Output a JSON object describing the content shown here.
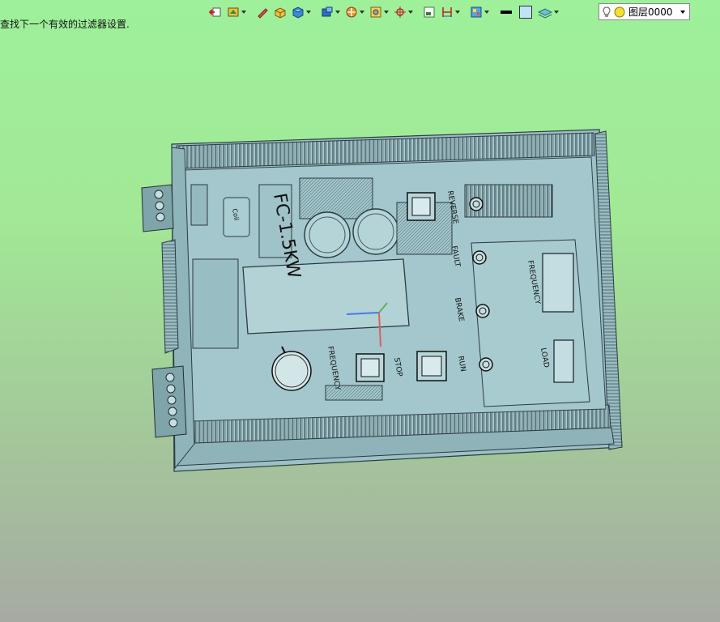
{
  "status": {
    "message": "查找下一个有效的过滤器设置."
  },
  "toolbar": {
    "icons": [
      "exit-sketch-icon",
      "snap-filter-icon",
      "pencil-icon",
      "box-solid-icon",
      "shaded-cube-icon",
      "render-style-icon",
      "section-view-icon",
      "wcs-display-icon",
      "csys-icon",
      "frame-icon",
      "dimension-icon",
      "view-palette-icon",
      "line-color-icon",
      "background-icon",
      "layer-visibility-icon"
    ]
  },
  "layer": {
    "current": "图层0000"
  },
  "model": {
    "labels": {
      "model_name": "FC-1.5KW",
      "reverse": "REVERSE",
      "fault": "FAULT",
      "brake": "BRAKE",
      "run": "RUN",
      "stop": "STOP",
      "frequency_knob": "FREQUENCY",
      "frequency_display": "FREQUENCY",
      "load": "LOAD",
      "coil": "Coil"
    }
  },
  "colors": {
    "background_top": "#9ef09a",
    "background_bottom": "#a6aaa2",
    "housing": "#9ec3c8",
    "housing_edge": "#2b3a40"
  }
}
